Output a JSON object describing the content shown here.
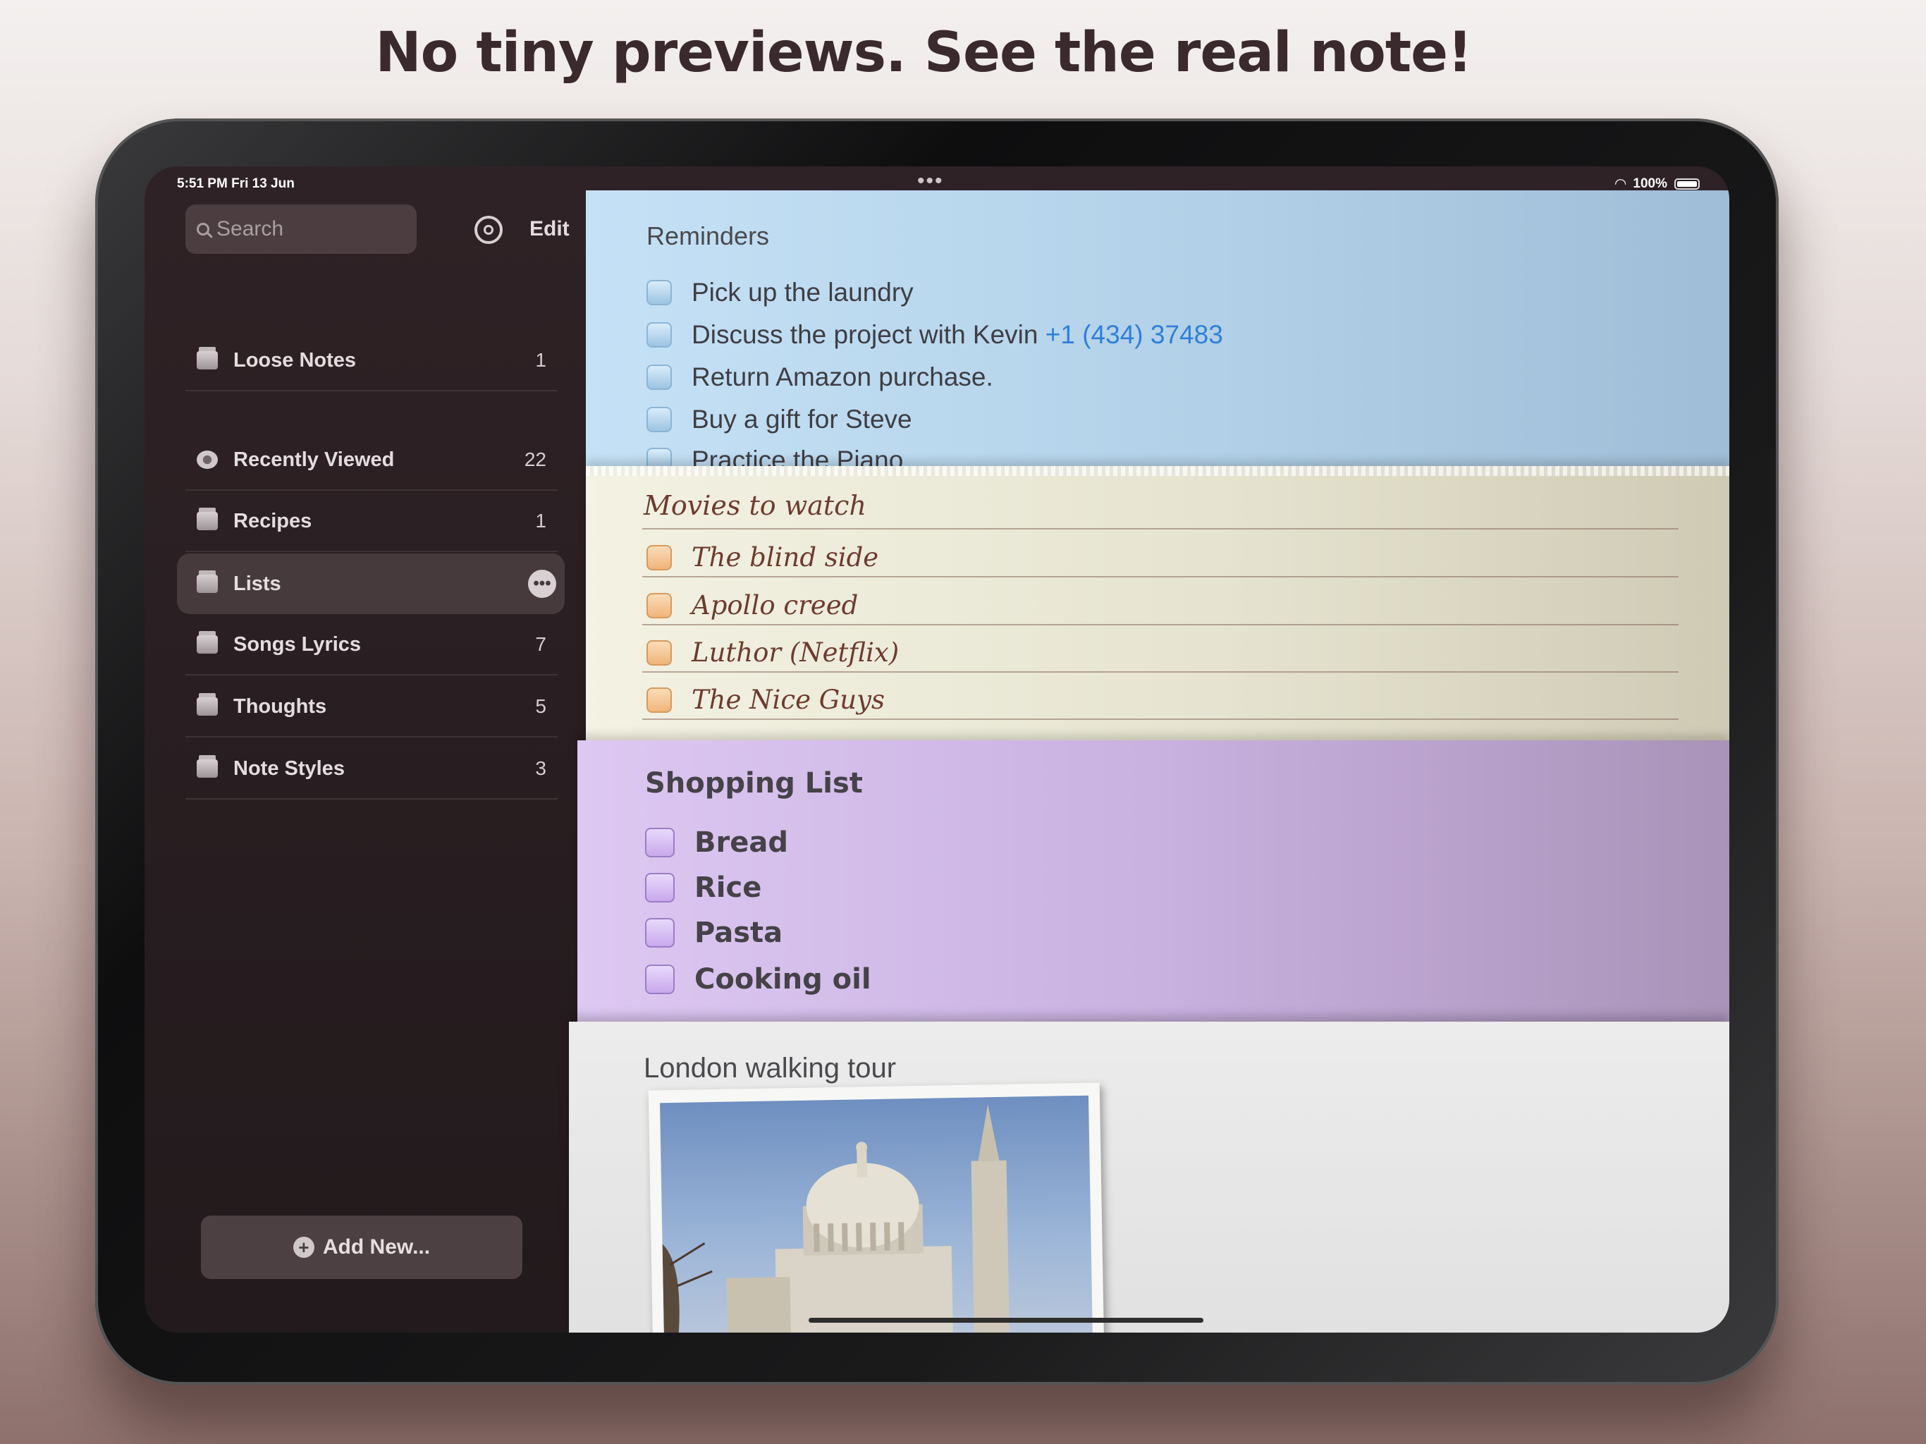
{
  "headline": "No tiny previews. See the real note!",
  "status_bar": {
    "time": "5:51 PM  Fri 13 Jun",
    "battery": "100%"
  },
  "sidebar": {
    "search_placeholder": "Search",
    "edit_label": "Edit",
    "items": [
      {
        "label": "Loose Notes",
        "count": "1"
      },
      {
        "label": "Recently Viewed",
        "count": "22"
      },
      {
        "label": "Recipes",
        "count": "1"
      },
      {
        "label": "Lists",
        "count": "",
        "selected": true
      },
      {
        "label": "Songs Lyrics",
        "count": "7"
      },
      {
        "label": "Thoughts",
        "count": "5"
      },
      {
        "label": "Note Styles",
        "count": "3"
      }
    ],
    "add_new_label": "Add New..."
  },
  "notes": {
    "reminders": {
      "title": "Reminders",
      "items": [
        "Pick up the laundry",
        "Discuss the project with Kevin",
        "Return Amazon purchase.",
        "Buy a gift for Steve",
        "Practice the Piano"
      ],
      "phone": "+1 (434) 37483"
    },
    "movies": {
      "title": "Movies to watch",
      "items": [
        "The blind side",
        "Apollo creed",
        "Luthor (Netflix)",
        "The Nice Guys"
      ]
    },
    "shopping": {
      "title": "Shopping List",
      "items": [
        "Bread",
        "Rice",
        "Pasta",
        "Cooking oil"
      ]
    },
    "london": {
      "title": "London walking tour"
    }
  }
}
